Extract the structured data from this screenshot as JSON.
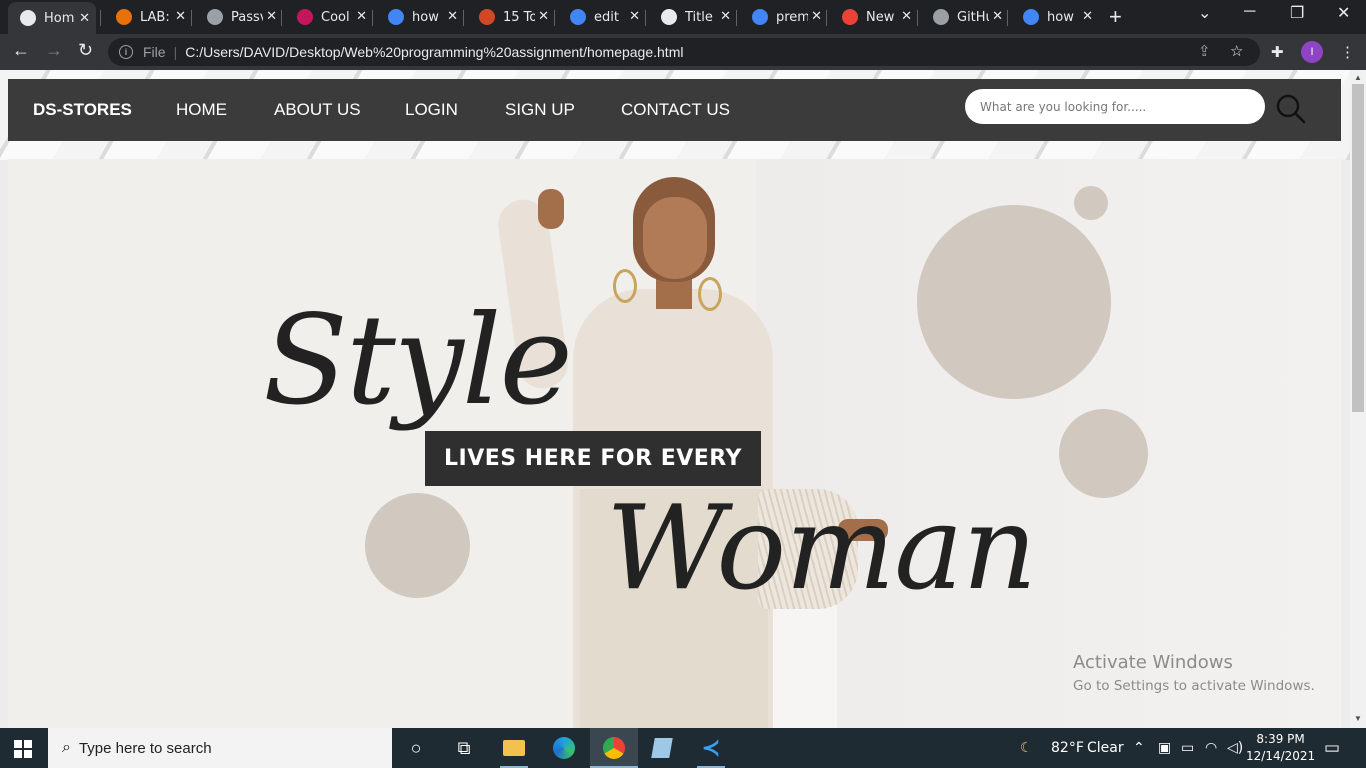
{
  "browser": {
    "tabs": [
      {
        "title": "Hom",
        "icon": "globe-icon",
        "color": "#e8eaed",
        "active": true
      },
      {
        "title": "LAB:",
        "icon": "lab-icon",
        "color": "#e8710a"
      },
      {
        "title": "Passv",
        "icon": "github-icon",
        "color": "#9aa0a6"
      },
      {
        "title": "Cool",
        "icon": "cool-icon",
        "color": "#c2185b"
      },
      {
        "title": "how",
        "icon": "google-icon",
        "color": "#4285f4"
      },
      {
        "title": "15 To",
        "icon": "powerpoint-icon",
        "color": "#d24726"
      },
      {
        "title": "edit",
        "icon": "google-icon",
        "color": "#4285f4"
      },
      {
        "title": "Title",
        "icon": "globe-icon",
        "color": "#e8eaed"
      },
      {
        "title": "prem",
        "icon": "google-icon",
        "color": "#4285f4"
      },
      {
        "title": "New",
        "icon": "gmail-icon",
        "color": "#ea4335"
      },
      {
        "title": "GitHu",
        "icon": "github-icon",
        "color": "#9aa0a6"
      },
      {
        "title": "how",
        "icon": "google-icon",
        "color": "#4285f4"
      }
    ],
    "scheme_label": "File",
    "url": "C:/Users/DAVID/Desktop/Web%20programming%20assignment/homepage.html",
    "profile_initial": "I"
  },
  "site": {
    "brand": "DS-STORES",
    "nav": [
      "HOME",
      "ABOUT US",
      "LOGIN",
      "SIGN UP",
      "CONTACT US"
    ],
    "search_placeholder": "What are you looking for.....",
    "hero": {
      "word_top": "Style",
      "tagline": "LIVES HERE FOR EVERY",
      "word_bottom": "Woman"
    }
  },
  "watermark": {
    "line1": "Activate Windows",
    "line2": "Go to Settings to activate Windows."
  },
  "taskbar": {
    "search_placeholder": "Type here to search",
    "weather_temp": "82°F",
    "weather_desc": "Clear",
    "time": "8:39 PM",
    "date": "12/14/2021"
  },
  "colors": {
    "nav_bg": "#3b3b3b",
    "hero_circle": "#d1c8bf",
    "tagline_bg": "#2f2f2f",
    "taskbar_bg": "#1f2b33"
  }
}
